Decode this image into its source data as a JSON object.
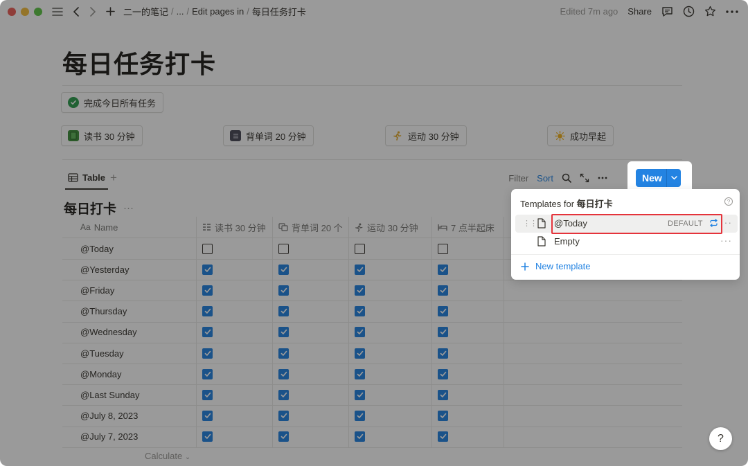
{
  "window": {
    "traffic_lights": [
      "#ec5f58",
      "#f4be3d",
      "#5fc647"
    ]
  },
  "breadcrumb": {
    "items": [
      "二一的笔记",
      "...",
      "Edit pages in",
      "每日任务打卡"
    ],
    "separator": "/"
  },
  "topbar": {
    "edited": "Edited 7m ago",
    "share_label": "Share"
  },
  "page": {
    "title": "每日任务打卡"
  },
  "chips": {
    "complete_all": "完成今日所有任务",
    "read": "读书 30 分钟",
    "vocab": "背单词 20 分钟",
    "exercise": "运动 30 分钟",
    "early": "成功早起"
  },
  "view": {
    "tab_label": "Table",
    "add": "+",
    "filter_label": "Filter",
    "sort_label": "Sort",
    "new_label": "New"
  },
  "database": {
    "title": "每日打卡",
    "more": "···"
  },
  "table": {
    "columns": [
      {
        "label": "Name",
        "icon": "Aa"
      },
      {
        "label": "读书 30 分钟"
      },
      {
        "label": "背单词 20 个"
      },
      {
        "label": "运动 30 分钟"
      },
      {
        "label": "7 点半起床"
      }
    ],
    "rows": [
      {
        "name": "@Today",
        "checks": [
          false,
          false,
          false,
          false
        ]
      },
      {
        "name": "@Yesterday",
        "checks": [
          true,
          true,
          true,
          true
        ]
      },
      {
        "name": "@Friday",
        "checks": [
          true,
          true,
          true,
          true
        ]
      },
      {
        "name": "@Thursday",
        "checks": [
          true,
          true,
          true,
          true
        ]
      },
      {
        "name": "@Wednesday",
        "checks": [
          true,
          true,
          true,
          true
        ]
      },
      {
        "name": "@Tuesday",
        "checks": [
          true,
          true,
          true,
          true
        ]
      },
      {
        "name": "@Monday",
        "checks": [
          true,
          true,
          true,
          true
        ]
      },
      {
        "name": "@Last Sunday",
        "checks": [
          true,
          true,
          true,
          true
        ]
      },
      {
        "name": "@July 8, 2023",
        "checks": [
          true,
          true,
          true,
          true
        ]
      },
      {
        "name": "@July 7, 2023",
        "checks": [
          true,
          true,
          true,
          true
        ]
      }
    ],
    "calculate_label": "Calculate"
  },
  "templates_popover": {
    "header_prefix": "Templates for",
    "header_db": "每日打卡",
    "items": [
      {
        "name": "@Today",
        "badge": "DEFAULT"
      },
      {
        "name": "Empty",
        "badge": ""
      }
    ],
    "new_template_label": "New template"
  },
  "help": {
    "label": "?"
  },
  "colors": {
    "accent": "#2383e2",
    "highlight": "#e5333b"
  }
}
